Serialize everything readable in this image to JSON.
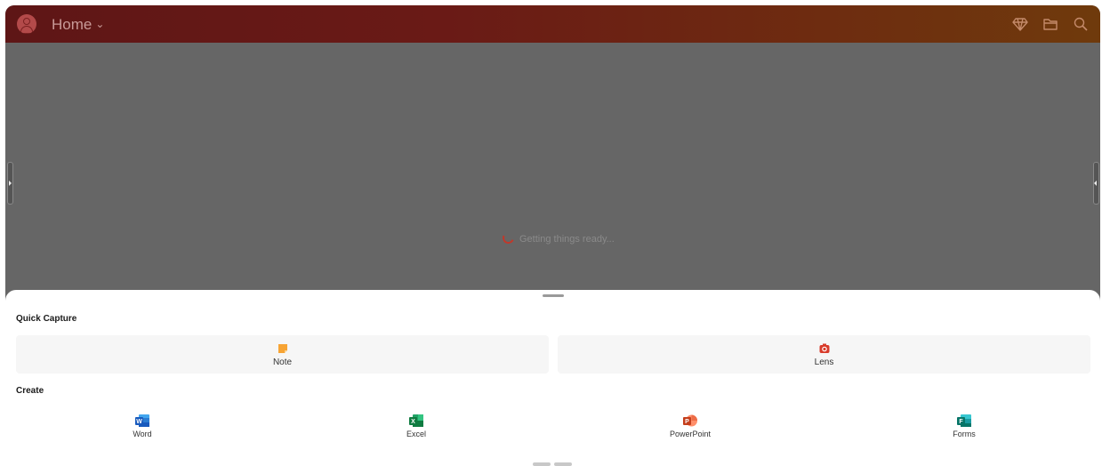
{
  "header": {
    "title": "Home",
    "accent_colors": [
      "#5e1616",
      "#6f3a0c"
    ],
    "icons": [
      "avatar-icon",
      "chevron-down-icon",
      "premium-diamond-icon",
      "folder-icon",
      "search-icon"
    ]
  },
  "main": {
    "loading_text": "Getting things ready..."
  },
  "sheet": {
    "quick_capture": {
      "title": "Quick Capture",
      "items": [
        {
          "label": "Note",
          "icon": "sticky-note-icon",
          "color": "#f7a434"
        },
        {
          "label": "Lens",
          "icon": "camera-icon",
          "color": "#d83b2a"
        }
      ]
    },
    "create": {
      "title": "Create",
      "items": [
        {
          "label": "Word",
          "icon": "word-icon",
          "color": "#2b579a"
        },
        {
          "label": "Excel",
          "icon": "excel-icon",
          "color": "#217346"
        },
        {
          "label": "PowerPoint",
          "icon": "powerpoint-icon",
          "color": "#d24726"
        },
        {
          "label": "Forms",
          "icon": "forms-icon",
          "color": "#077568"
        }
      ]
    }
  }
}
